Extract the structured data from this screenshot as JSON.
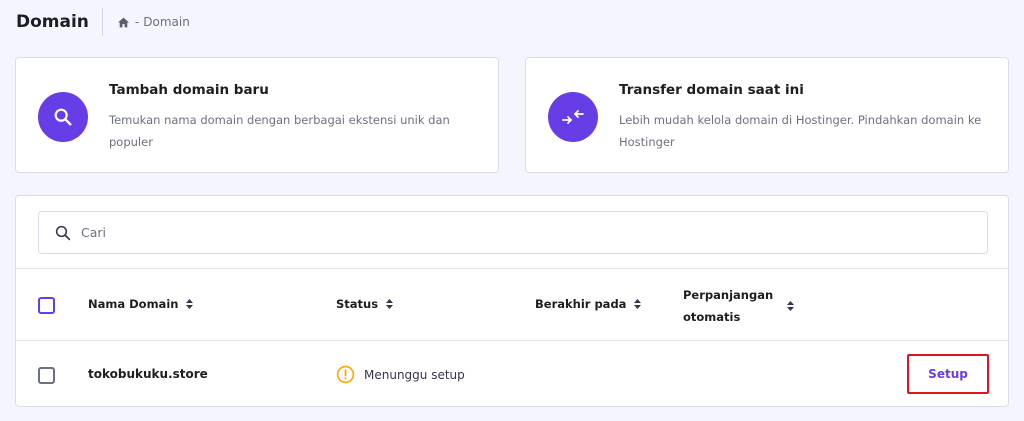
{
  "header": {
    "title": "Domain",
    "breadcrumb": {
      "home_icon": "home-icon",
      "separator": "-",
      "current": "Domain"
    }
  },
  "cards": [
    {
      "icon": "search-icon",
      "title": "Tambah domain baru",
      "description": "Temukan nama domain dengan berbagai ekstensi unik dan populer"
    },
    {
      "icon": "transfer-arrows-icon",
      "title": "Transfer domain saat ini",
      "description": "Lebih mudah kelola domain di Hostinger. Pindahkan domain ke Hostinger"
    }
  ],
  "search": {
    "placeholder": "Cari",
    "value": ""
  },
  "table": {
    "columns": [
      {
        "label": "Nama Domain",
        "sortable": true
      },
      {
        "label": "Status",
        "sortable": true
      },
      {
        "label": "Berakhir pada",
        "sortable": true
      },
      {
        "label": "Perpanjangan otomatis",
        "sortable": true
      }
    ],
    "rows": [
      {
        "domain": "tokobukuku.store",
        "status": "Menunggu setup",
        "status_icon": "warning-icon",
        "expiry": "",
        "auto_renew": "",
        "action": "Setup"
      }
    ]
  },
  "colors": {
    "accent": "#673de6",
    "warning": "#ffa500",
    "highlight_border": "#e0131f",
    "background": "#f4f5ff"
  }
}
